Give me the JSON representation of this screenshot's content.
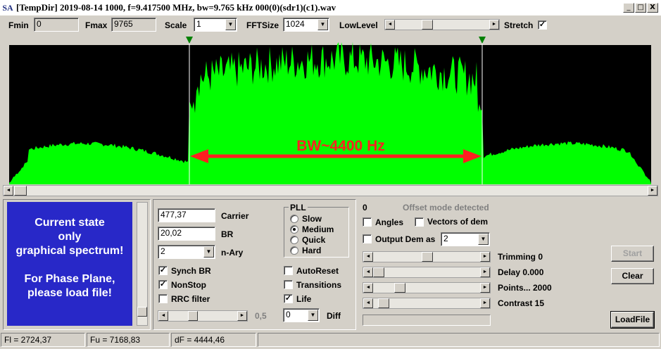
{
  "window": {
    "icon_text": "SA",
    "title": "[TempDir] 2019-08-14 1000, f=9.417500 MHz, bw=9.765 kHz 000(0)(sdr1)(c1).wav",
    "minimize": "_",
    "maximize": "□",
    "close": "X"
  },
  "toolbar": {
    "fmin_label": "Fmin",
    "fmin_value": "0",
    "fmax_label": "Fmax",
    "fmax_value": "9765",
    "scale_label": "Scale",
    "scale_value": "1",
    "fftsize_label": "FFTSize",
    "fftsize_value": "1024",
    "lowlevel_label": "LowLevel",
    "lowlevel_position": 0.62,
    "stretch_label": "Stretch",
    "stretch_checked": true
  },
  "spectrum": {
    "annotation": "BW~4400 Hz",
    "colors": {
      "background": "#000000",
      "fill": "#00ff00",
      "arrow": "#ff2020",
      "marker": "#008000"
    },
    "scroll_left": "◄",
    "scroll_right": "►"
  },
  "phase_plane": {
    "line1": "Current state",
    "line2": "only",
    "line3": "graphical spectrum!",
    "line4": "For Phase Plane,",
    "line5": "please load file!",
    "color": "#2828c8"
  },
  "params": {
    "carrier_value": "477,37",
    "carrier_label": "Carrier",
    "br_value": "20,02",
    "br_label": "BR",
    "nary_value": "2",
    "nary_label": "n-Ary",
    "synch_br_label": "Synch BR",
    "synch_br_checked": true,
    "nonstop_label": "NonStop",
    "nonstop_checked": true,
    "rrc_label": "RRC filter",
    "rrc_checked": false,
    "rrc_value": "0,5",
    "rrc_position": 0.3
  },
  "pll": {
    "title": "PLL",
    "options": [
      "Slow",
      "Medium",
      "Quick",
      "Hard"
    ],
    "selected": "Medium",
    "autoreset_label": "AutoReset",
    "autoreset_checked": false,
    "transitions_label": "Transitions",
    "transitions_checked": false,
    "life_label": "Life",
    "life_checked": true,
    "diff_value": "0",
    "diff_label": "Diff"
  },
  "demod": {
    "counter": "0",
    "offset_text": "Offset mode detected",
    "angles_label": "Angles",
    "angles_checked": false,
    "vectors_label": "Vectors of dem",
    "vectors_checked": false,
    "output_label": "Output Dem as",
    "output_checked": false,
    "output_value": "2",
    "trimming_label": "Trimming 0",
    "trimming_position": 0.52,
    "delay_label": "Delay  0.000",
    "delay_position": 0.0,
    "points_label": "Points... 2000",
    "points_position": 0.24,
    "contrast_label": "Contrast 15",
    "contrast_position": 0.05
  },
  "buttons": {
    "start": "Start",
    "clear": "Clear",
    "loadfile": "LoadFile"
  },
  "statusbar": {
    "fl": "Fl = 2724,37",
    "fu": "Fu = 7168,83",
    "df": "dF = 4444,46"
  }
}
